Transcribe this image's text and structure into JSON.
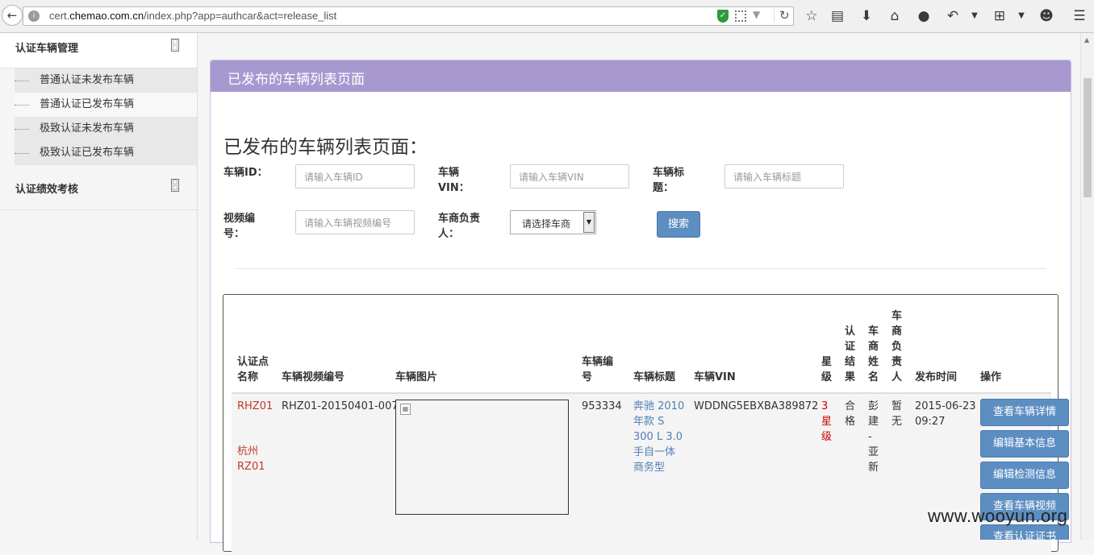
{
  "browser": {
    "url_prefix": "cert.",
    "url_domain": "chemao.com.cn",
    "url_path": "/index.php?app=authcar&act=release_list"
  },
  "sidebar": {
    "group1_title": "认证车辆管理",
    "items": [
      {
        "label": "普通认证未发布车辆"
      },
      {
        "label": "普通认证已发布车辆"
      },
      {
        "label": "极致认证未发布车辆"
      },
      {
        "label": "极致认证已发布车辆"
      }
    ],
    "group2_title": "认证绩效考核"
  },
  "panel": {
    "header": "已发布的车辆列表页面",
    "title": "已发布的车辆列表页面："
  },
  "filters": {
    "car_id_label": "车辆ID：",
    "car_id_placeholder": "请输入车辆ID",
    "vin_label_1": "车辆",
    "vin_label_2": "VIN：",
    "vin_placeholder": "请输入车辆VIN",
    "title_label_1": "车辆标",
    "title_label_2": "题：",
    "title_placeholder": "请输入车辆标题",
    "video_label_1": "视频编",
    "video_label_2": "号：",
    "video_placeholder": "请输入车辆视频编号",
    "dealer_label_1": "车商负责",
    "dealer_label_2": "人：",
    "dealer_selected": "请选择车商",
    "search_button": "搜索"
  },
  "table": {
    "headers": {
      "point_1": "认证点",
      "point_2": "名称",
      "video_no": "车辆视频编号",
      "image": "车辆图片",
      "car_no_1": "车辆编",
      "car_no_2": "号",
      "title": "车辆标题",
      "vin": "车辆VIN",
      "star_1": "星",
      "star_2": "级",
      "result": [
        "认",
        "证",
        "结",
        "果"
      ],
      "dealer_name": [
        "车",
        "商",
        "姓",
        "名"
      ],
      "dealer_owner": [
        "车",
        "商",
        "负",
        "责",
        "人"
      ],
      "publish_time": "发布时间",
      "actions": "操作"
    },
    "row": {
      "point_a": "RHZ01",
      "point_b1": "杭州",
      "point_b2": "RZ01",
      "video_no": "RHZ01-20150401-007",
      "car_no": "953334",
      "title_lines": [
        "奔驰 2010",
        "年款 S",
        "300 L 3.0",
        "手自一体",
        "商务型"
      ],
      "vin": "WDDNG5EBXBA389872",
      "star_lines": [
        "3",
        "星",
        "级"
      ],
      "result_lines": [
        "合",
        "格"
      ],
      "dealer_lines": [
        "彭",
        "建",
        "-",
        "亚",
        "新"
      ],
      "owner_lines": [
        "暂",
        "无"
      ],
      "date": "2015-06-23",
      "time": "09:27",
      "buttons": [
        "查看车辆详情",
        "编辑基本信息",
        "编辑检测信息",
        "查看车辆视频",
        "查看认证证书"
      ]
    }
  },
  "watermark": "www.wooyun.org"
}
